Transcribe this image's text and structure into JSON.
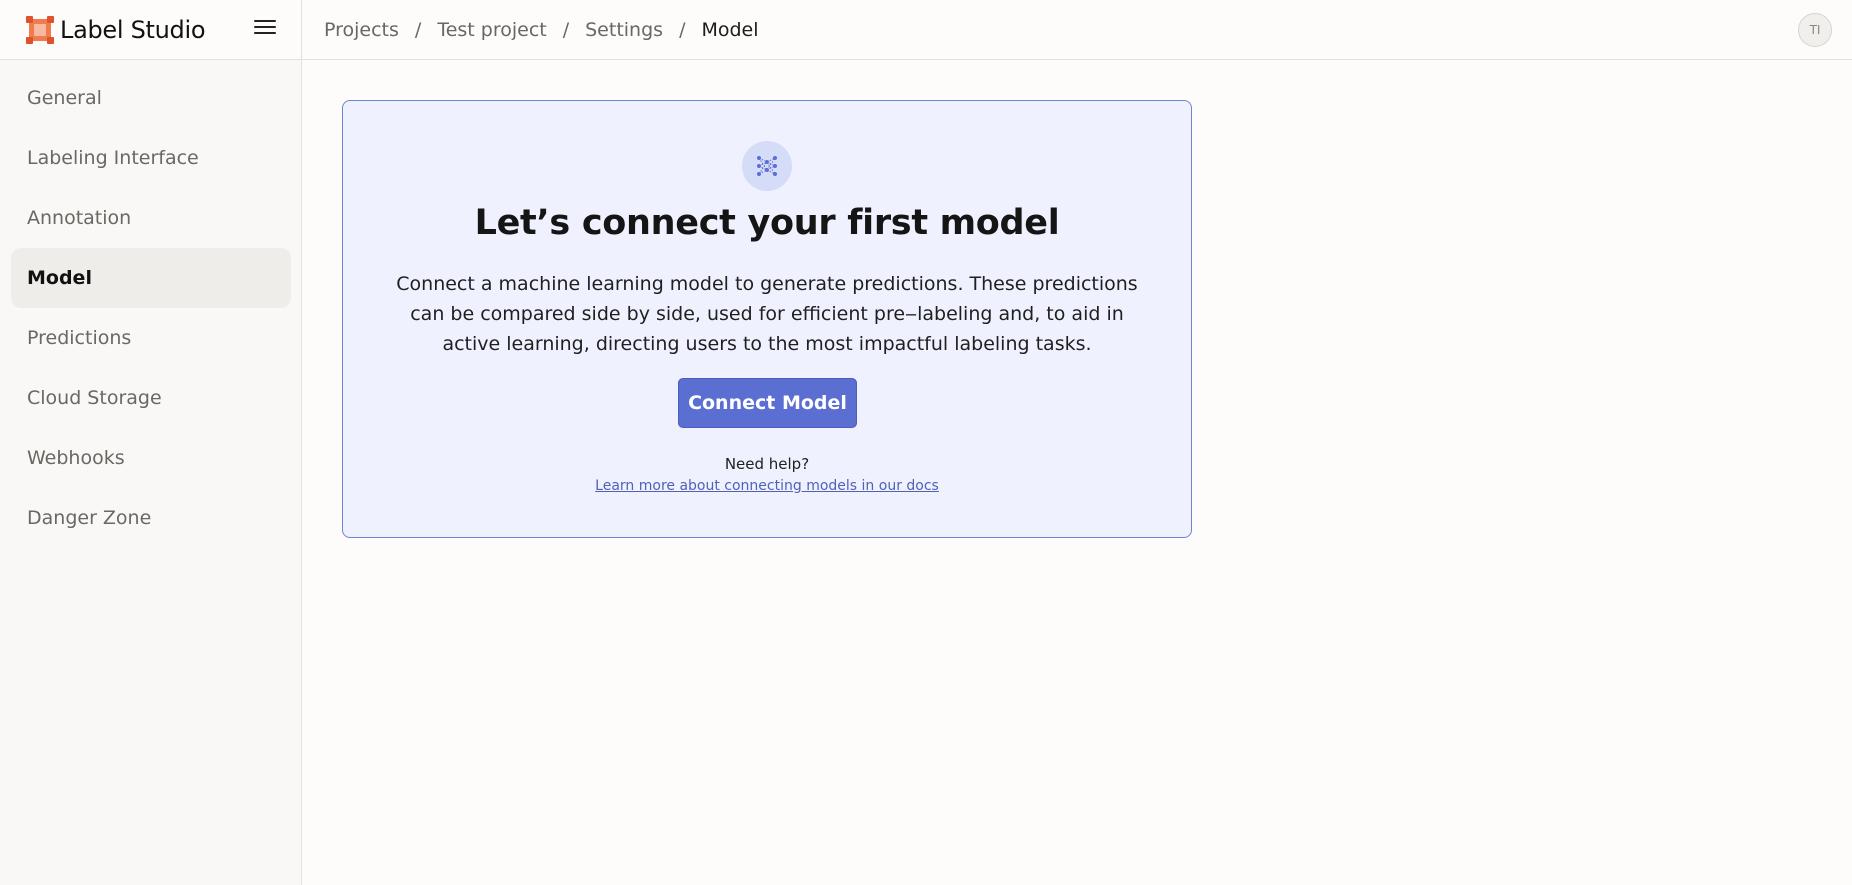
{
  "brand": {
    "name": "Label Studio"
  },
  "header": {
    "breadcrumbs": [
      {
        "label": "Projects"
      },
      {
        "label": "Test project"
      },
      {
        "label": "Settings"
      },
      {
        "label": "Model"
      }
    ],
    "separator": "/",
    "avatar_initials": "TI"
  },
  "sidebar": {
    "items": [
      {
        "label": "General"
      },
      {
        "label": "Labeling Interface"
      },
      {
        "label": "Annotation"
      },
      {
        "label": "Model",
        "active": true
      },
      {
        "label": "Predictions"
      },
      {
        "label": "Cloud Storage"
      },
      {
        "label": "Webhooks"
      },
      {
        "label": "Danger Zone"
      }
    ]
  },
  "main": {
    "card": {
      "icon": "neural-network-icon",
      "title": "Let’s connect your first model",
      "description": "Connect a machine learning model to generate predictions. These predictions can be compared side by side, used for efficient pre‒labeling and, to aid in active learning, directing users to the most impactful labeling tasks.",
      "button_label": "Connect Model",
      "help_label": "Need help?",
      "help_link": "Learn more about connecting models in our docs"
    }
  },
  "colors": {
    "accent": "#5b6fd2",
    "card_bg": "#eff1fe",
    "card_border": "#6d84d4",
    "logo": "#f07b4f"
  }
}
